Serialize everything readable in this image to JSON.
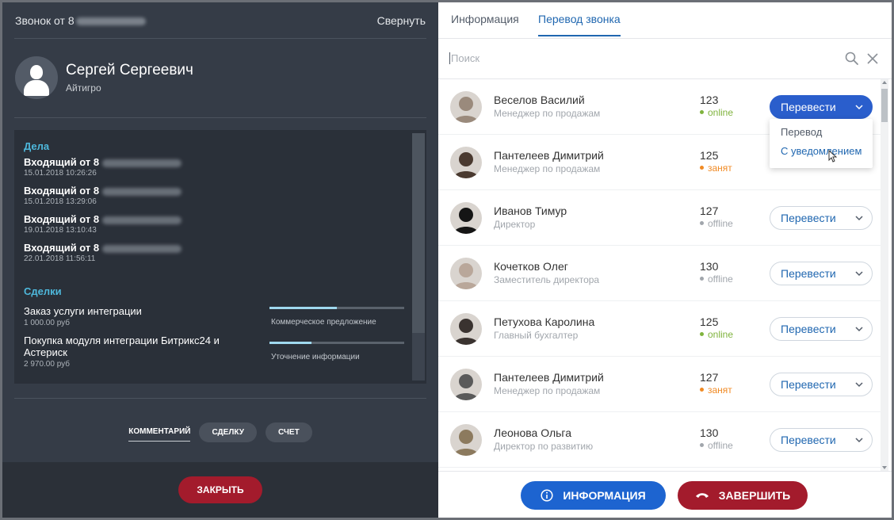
{
  "call_panel": {
    "title": "Звонок от 8",
    "collapse_label": "Свернуть",
    "caller": {
      "name": "Сергей Сергеевич",
      "company": "Айтигро"
    },
    "tasks_section": {
      "title": "Дела",
      "items": [
        {
          "title": "Входящий от 8",
          "date": "15.01.2018 10:26:26"
        },
        {
          "title": "Входящий от 8",
          "date": "15.01.2018 13:29:06"
        },
        {
          "title": "Входящий от 8",
          "date": "19.01.2018 13:10:43"
        },
        {
          "title": "Входящий от 8",
          "date": "22.01.2018 11:56:11"
        }
      ]
    },
    "deals_section": {
      "title": "Сделки",
      "items": [
        {
          "title": "Заказ услуги интеграции",
          "price": "1 000.00 руб",
          "stage": "Коммерческое предложение",
          "progress": 0.5
        },
        {
          "title": "Покупка модуля интеграции Битрикс24 и Астериск",
          "price": "2 970.00 руб",
          "stage": "Уточнение информации",
          "progress": 0.31
        }
      ]
    },
    "actions": {
      "comment": "КОММЕНТАРИЙ",
      "deal": "СДЕЛКУ",
      "invoice": "СЧЕТ"
    },
    "close_label": "ЗАКРЫТЬ"
  },
  "transfer_panel": {
    "tabs": [
      {
        "label": "Информация",
        "active": false
      },
      {
        "label": "Перевод звонка",
        "active": true
      }
    ],
    "search": {
      "placeholder": "Поиск",
      "value": ""
    },
    "transfer_label": "Перевести",
    "dropdown": [
      "Перевод",
      "С уведомлением"
    ],
    "employees": [
      {
        "name": "Веселов Василий",
        "role": "Менеджер по продажам",
        "ext": "123",
        "status": "online",
        "avatar_color": "#9a8a7c"
      },
      {
        "name": "Пантелеев Димитрий",
        "role": "Менеджер по продажам",
        "ext": "125",
        "status": "занят",
        "avatar_color": "#4a3a30"
      },
      {
        "name": "Иванов Тимур",
        "role": "Директор",
        "ext": "127",
        "status": "offline",
        "avatar_color": "#151515"
      },
      {
        "name": "Кочетков Олег",
        "role": "Заместитель директора",
        "ext": "130",
        "status": "offline",
        "avatar_color": "#b9a79a"
      },
      {
        "name": "Петухова Каролина",
        "role": "Главный бухгалтер",
        "ext": "125",
        "status": "online",
        "avatar_color": "#3a3330"
      },
      {
        "name": "Пантелеев Димитрий",
        "role": "Менеджер по продажам",
        "ext": "127",
        "status": "занят",
        "avatar_color": "#5a5a5a"
      },
      {
        "name": "Леонова Ольга",
        "role": "Директор по развитию",
        "ext": "130",
        "status": "offline",
        "avatar_color": "#8c7a5e"
      }
    ],
    "info_button": "ИНФОРМАЦИЯ",
    "end_button": "ЗАВЕРШИТЬ"
  },
  "colors": {
    "accent": "#2067b0",
    "primary_button": "#1d64d0",
    "danger": "#a31b2c",
    "online": "#7fb33d",
    "busy": "#f08a24",
    "offline": "#a1a6ac"
  }
}
